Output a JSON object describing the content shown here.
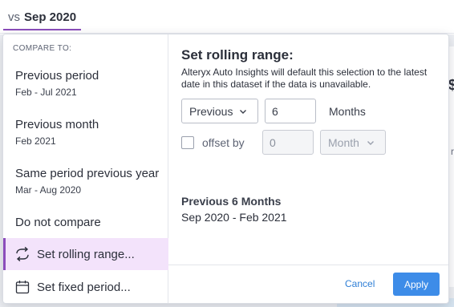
{
  "header": {
    "vs_prefix": "vs",
    "selected_period": "Sep 2020"
  },
  "background": {
    "peek_a": "",
    "peek_s": "$",
    "peek_t": "rt"
  },
  "popover": {
    "left_list": {
      "heading": "COMPARE TO:",
      "options": [
        {
          "label": "Previous period",
          "sub": "Feb - Jul 2021"
        },
        {
          "label": "Previous month",
          "sub": "Feb 2021"
        },
        {
          "label": "Same period previous year",
          "sub": "Mar - Aug 2020"
        },
        {
          "label": "Do not compare",
          "sub": ""
        }
      ],
      "rolling_label": "Set rolling range...",
      "fixed_label": "Set fixed period...",
      "selected": "Set rolling range...",
      "icons": {
        "rolling": "rolling-range-icon",
        "fixed": "calendar-icon"
      }
    },
    "right_panel": {
      "title": "Set rolling range:",
      "description": "Alteryx Auto Insights will default this selection to the latest date in this dataset if the data is unavailable.",
      "direction_select": "Previous",
      "count_value": "6",
      "unit_label": "Months",
      "offset_checked": false,
      "offset_label": "offset by",
      "offset_value": "0",
      "offset_unit_select": "Month",
      "summary_title": "Previous 6 Months",
      "summary_range": "Sep 2020 - Feb 2021",
      "cancel_label": "Cancel",
      "apply_label": "Apply"
    }
  },
  "colors": {
    "accent_purple": "#8b4dbb",
    "selected_bg": "#f3e3fb",
    "primary_blue": "#3d8ce8",
    "link_blue": "#2f7fd6"
  }
}
